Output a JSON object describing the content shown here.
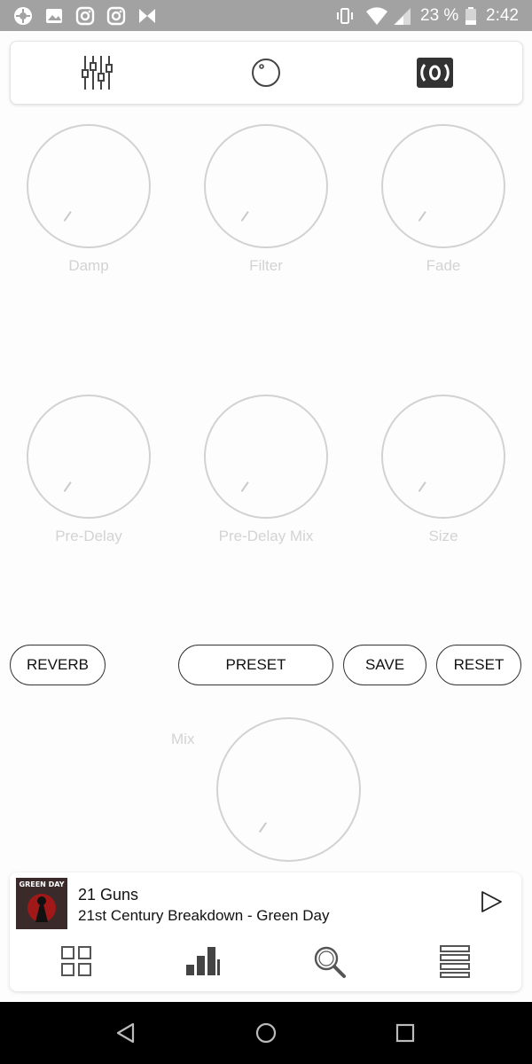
{
  "status_bar": {
    "battery_percent": "23 %",
    "time": "2:42",
    "icons": [
      "settings-app-icon",
      "gallery-icon",
      "instagram-icon",
      "instagram-icon",
      "bowtie-app-icon",
      "vibrate-icon",
      "wifi-icon",
      "signal-icon",
      "battery-icon"
    ]
  },
  "top_tabs": [
    "equalizer-sliders-icon",
    "knob-icon",
    "surround-icon"
  ],
  "knobs": [
    {
      "label": "Damp"
    },
    {
      "label": "Filter"
    },
    {
      "label": "Fade"
    },
    {
      "label": "Pre-Delay"
    },
    {
      "label": "Pre-Delay Mix"
    },
    {
      "label": "Size"
    }
  ],
  "buttons": {
    "reverb": "REVERB",
    "preset": "PRESET",
    "save": "SAVE",
    "reset": "RESET"
  },
  "mix": {
    "label": "Mix"
  },
  "player": {
    "title": "21 Guns",
    "subtitle": "21st Century Breakdown - Green Day",
    "album_art_text": "GREEN DAY"
  },
  "bottom_nav": [
    "grid-icon",
    "bar-chart-icon",
    "search-icon",
    "list-icon"
  ],
  "system_nav": [
    "back-icon",
    "home-icon",
    "recents-icon"
  ]
}
